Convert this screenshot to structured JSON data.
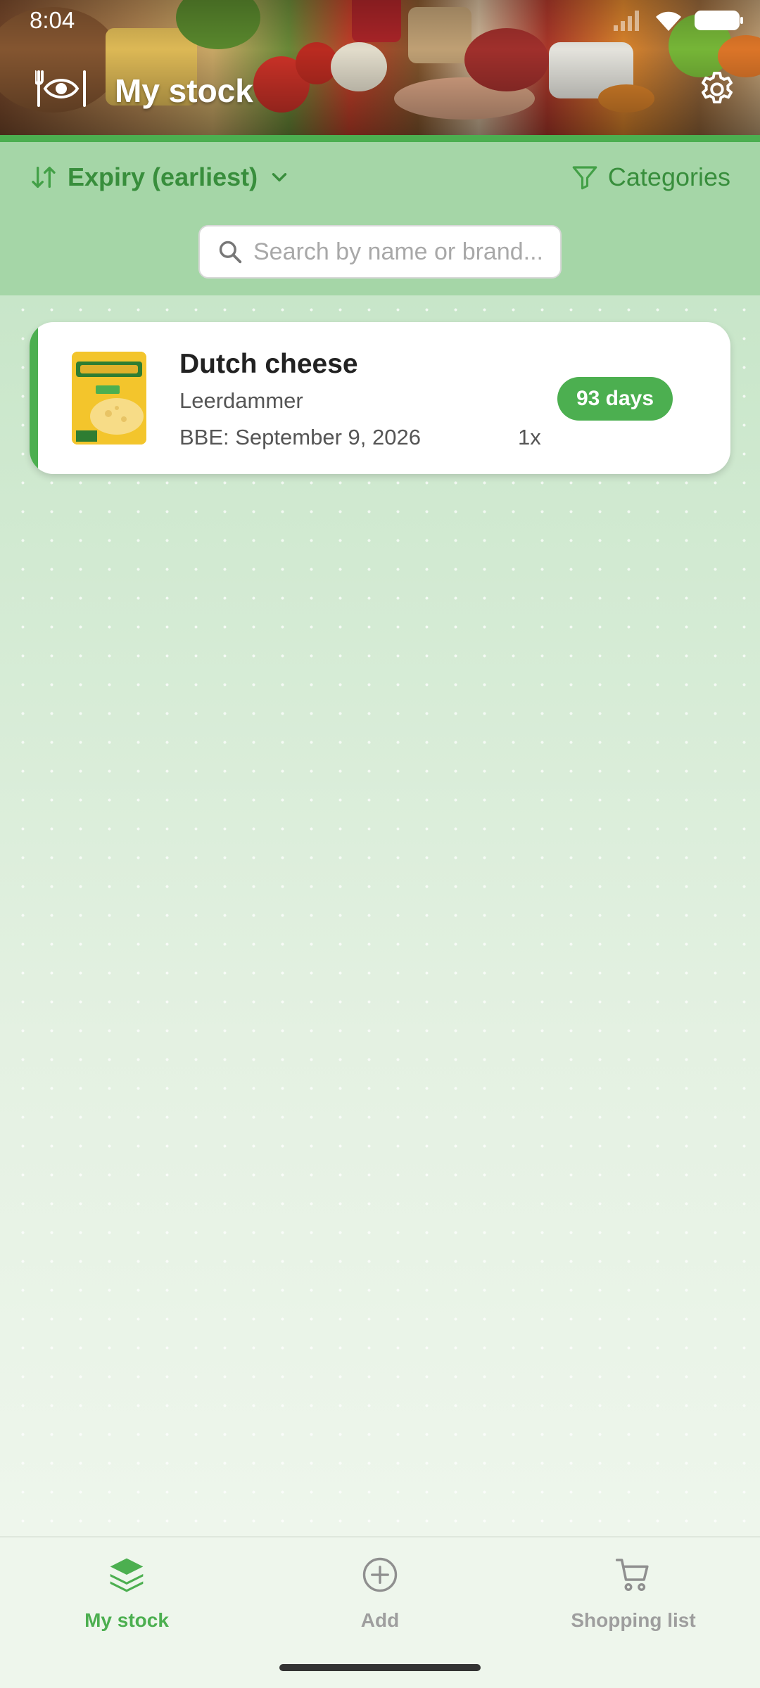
{
  "status_bar": {
    "time": "8:04"
  },
  "header": {
    "title": "My stock",
    "logo_icon": "fork-eye-knife-icon",
    "settings_icon": "gear-icon"
  },
  "toolbar": {
    "sort_label": "Expiry (earliest)",
    "sort_icon": "sort-arrows-icon",
    "categories_label": "Categories",
    "categories_icon": "filter-icon",
    "search_placeholder": "Search by name or brand..."
  },
  "stock_items": [
    {
      "name": "Dutch cheese",
      "brand": "Leerdammer",
      "bbe": "BBE: September 9, 2026",
      "quantity": "1x",
      "days_left": "93 days"
    }
  ],
  "bottom_nav": [
    {
      "label": "My stock",
      "icon": "layers-icon",
      "active": true
    },
    {
      "label": "Add",
      "icon": "plus-circle-icon",
      "active": false
    },
    {
      "label": "Shopping list",
      "icon": "cart-icon",
      "active": false
    }
  ],
  "colors": {
    "accent": "#4caf50",
    "toolbar_bg": "#a5d6a7",
    "accent_text": "#388e3c"
  }
}
